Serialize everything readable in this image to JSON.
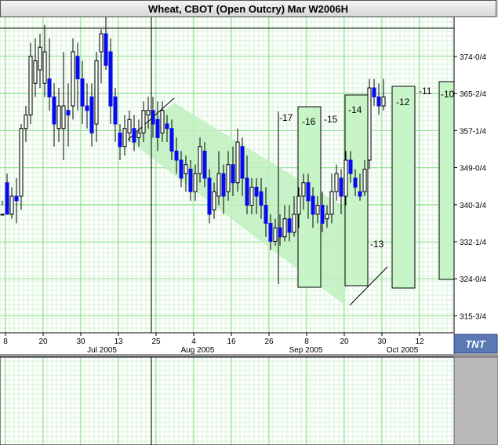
{
  "window": {
    "title": "Wheat, CBOT (Open Outcry) Mar W2006H"
  },
  "colors": {
    "background": "#ffffff",
    "grid_major": "#8fe08f",
    "grid_minor": "#d6f3d6",
    "candle": "#0a0aee",
    "channel": "#bff0bf",
    "frame": "#000000"
  },
  "logo": {
    "text": "TNT"
  },
  "chart_data": {
    "type": "candlestick",
    "title": "Wheat, CBOT (Open Outcry) Mar W2006H",
    "y_ticks": [
      "374-0/4",
      "365-2/4",
      "357-1/4",
      "349-0/4",
      "340-3/4",
      "332-1/4",
      "324-0/4",
      "315-3/4"
    ],
    "x_ticks": [
      "8",
      "20",
      "30",
      "13",
      "25",
      "4",
      "16",
      "26",
      "8",
      "20",
      "30",
      "12"
    ],
    "x_months": [
      "Jul 2005",
      "Aug 2005",
      "Sep 2005",
      "Oct 2005"
    ],
    "time_labels": [
      "-17",
      "-16",
      "-15",
      "-14",
      "-13",
      "-12",
      "-11",
      "-10"
    ],
    "candles": [
      [
        336,
        336,
        339,
        338
      ],
      [
        343,
        336,
        345,
        339
      ],
      [
        336,
        340,
        342,
        335
      ],
      [
        340,
        339,
        344,
        334
      ],
      [
        340,
        355,
        356,
        337
      ],
      [
        355,
        358,
        360,
        352
      ],
      [
        358,
        371,
        374,
        356
      ],
      [
        365,
        370,
        375,
        362
      ],
      [
        368,
        373,
        376,
        364
      ],
      [
        365,
        372,
        378,
        362
      ],
      [
        366,
        362,
        375,
        359
      ],
      [
        362,
        356,
        365,
        351
      ],
      [
        355,
        360,
        364,
        352
      ],
      [
        355,
        360,
        372,
        348
      ],
      [
        359,
        358,
        365,
        351
      ],
      [
        360,
        372,
        375,
        357
      ],
      [
        371,
        366,
        374,
        359
      ],
      [
        366,
        360,
        370,
        356
      ],
      [
        360,
        359,
        365,
        355
      ],
      [
        362,
        354,
        365,
        351
      ],
      [
        356,
        370,
        372,
        352
      ],
      [
        372,
        376,
        377,
        365
      ],
      [
        376,
        369,
        381,
        368
      ],
      [
        372,
        360,
        375,
        356
      ],
      [
        362,
        356,
        364,
        352
      ],
      [
        354,
        351,
        356,
        348
      ],
      [
        351,
        355,
        358,
        349
      ],
      [
        354,
        357,
        359,
        352
      ],
      [
        355,
        352,
        358,
        350
      ],
      [
        353,
        354,
        357,
        351
      ],
      [
        354,
        359,
        361,
        352
      ],
      [
        358,
        359,
        362,
        355
      ],
      [
        359,
        356,
        362,
        353
      ],
      [
        357,
        353,
        361,
        350
      ],
      [
        354,
        359,
        361,
        352
      ],
      [
        356,
        355,
        358,
        352
      ],
      [
        355,
        350,
        357,
        348
      ],
      [
        350,
        348,
        353,
        345
      ],
      [
        348,
        344,
        350,
        342
      ],
      [
        345,
        347,
        349,
        341
      ],
      [
        346,
        341,
        348,
        339
      ],
      [
        341,
        345,
        347,
        339
      ],
      [
        345,
        351,
        353,
        343
      ],
      [
        350,
        344,
        352,
        342
      ],
      [
        344,
        336,
        346,
        334
      ],
      [
        337,
        341,
        343,
        335
      ],
      [
        340,
        345,
        350,
        338
      ],
      [
        345,
        340,
        347,
        336
      ],
      [
        341,
        347,
        350,
        339
      ],
      [
        347,
        343,
        351,
        340
      ],
      [
        343,
        352,
        355,
        341
      ],
      [
        351,
        344,
        353,
        340
      ],
      [
        344,
        338,
        349,
        336
      ],
      [
        338,
        342,
        344,
        336
      ],
      [
        342,
        340,
        344,
        336
      ],
      [
        341,
        338,
        344,
        335
      ],
      [
        338,
        334,
        342,
        331
      ],
      [
        334,
        330,
        336,
        328
      ],
      [
        330,
        333,
        335,
        329
      ],
      [
        333,
        331,
        336,
        329
      ],
      [
        331,
        335,
        338,
        330
      ],
      [
        335,
        332,
        338,
        330
      ],
      [
        332,
        336,
        340,
        331
      ],
      [
        336,
        340,
        342,
        333
      ],
      [
        340,
        343,
        345,
        337
      ],
      [
        343,
        339,
        345,
        335
      ],
      [
        340,
        336,
        342,
        333
      ],
      [
        336,
        338,
        340,
        334
      ],
      [
        338,
        334,
        341,
        332
      ],
      [
        335,
        336,
        338,
        333
      ],
      [
        336,
        341,
        345,
        334
      ],
      [
        341,
        345,
        347,
        339
      ],
      [
        344,
        340,
        346,
        336
      ],
      [
        340,
        348,
        350,
        338
      ],
      [
        348,
        345,
        350,
        343
      ],
      [
        344,
        342,
        346,
        340
      ],
      [
        341,
        340,
        345,
        339
      ],
      [
        341,
        346,
        348,
        340
      ],
      [
        348,
        364,
        366,
        346
      ],
      [
        364,
        362,
        366,
        360
      ],
      [
        362,
        360,
        365,
        358
      ],
      [
        360,
        362,
        366,
        359
      ]
    ]
  }
}
